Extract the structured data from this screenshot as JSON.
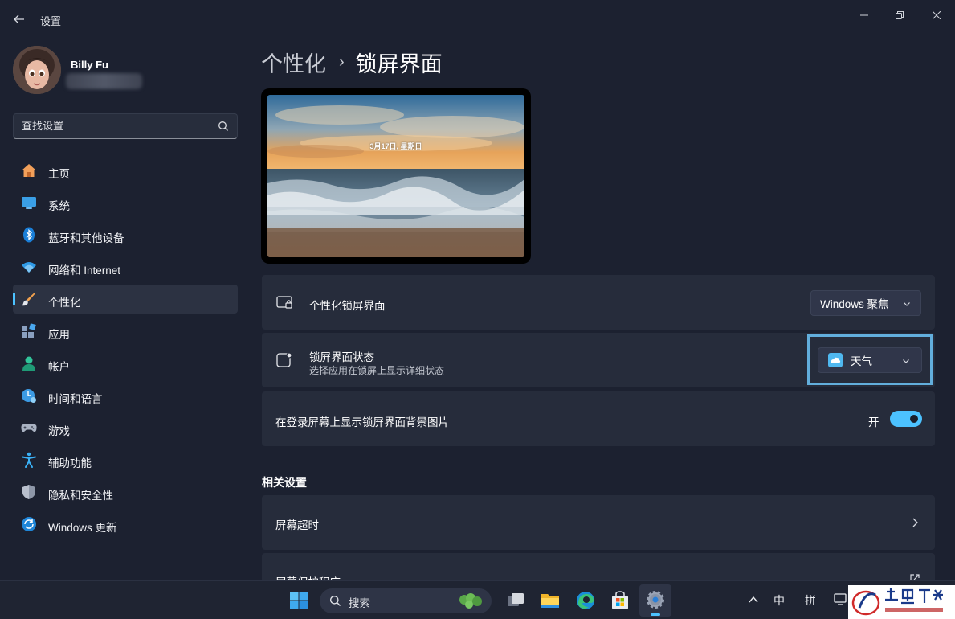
{
  "window": {
    "title": "设置",
    "back_icon": "back-arrow-icon",
    "controls": [
      "minimize-icon",
      "restore-icon",
      "close-icon"
    ]
  },
  "profile": {
    "name": "Billy Fu"
  },
  "search": {
    "placeholder": "查找设置"
  },
  "sidebar": {
    "items": [
      {
        "label": "主页",
        "icon": "home-icon"
      },
      {
        "label": "系统",
        "icon": "system-icon"
      },
      {
        "label": "蓝牙和其他设备",
        "icon": "bluetooth-icon"
      },
      {
        "label": "网络和 Internet",
        "icon": "wifi-icon"
      },
      {
        "label": "个性化",
        "icon": "personalization-brush-icon",
        "active": true
      },
      {
        "label": "应用",
        "icon": "apps-icon"
      },
      {
        "label": "帐户",
        "icon": "account-icon"
      },
      {
        "label": "时间和语言",
        "icon": "time-language-icon"
      },
      {
        "label": "游戏",
        "icon": "gaming-icon"
      },
      {
        "label": "辅助功能",
        "icon": "accessibility-icon"
      },
      {
        "label": "隐私和安全性",
        "icon": "privacy-shield-icon"
      },
      {
        "label": "Windows 更新",
        "icon": "windows-update-icon"
      }
    ]
  },
  "header": {
    "parent": "个性化",
    "separator": "›",
    "current": "锁屏界面"
  },
  "preview": {
    "date_text": "3月17日, 星期日"
  },
  "settings": {
    "lockscreen": {
      "title": "个性化锁屏界面",
      "value": "Windows 聚焦"
    },
    "status": {
      "title": "锁屏界面状态",
      "subtitle": "选择应用在锁屏上显示详细状态",
      "value": "天气"
    },
    "signin_bg": {
      "title": "在登录屏幕上显示锁屏界面背景图片",
      "state_label": "开",
      "enabled": true
    }
  },
  "related": {
    "title": "相关设置",
    "items": [
      {
        "label": "屏幕超时"
      },
      {
        "label": "屏幕保护程序"
      }
    ]
  },
  "taskbar": {
    "search_label": "搜索",
    "tray": {
      "ime_lang": "中",
      "ime_mode": "拼"
    }
  },
  "colors": {
    "accent": "#4cc2ff",
    "highlight_border": "#62aedc",
    "background": "#1c2130",
    "card": "#262c3b"
  }
}
